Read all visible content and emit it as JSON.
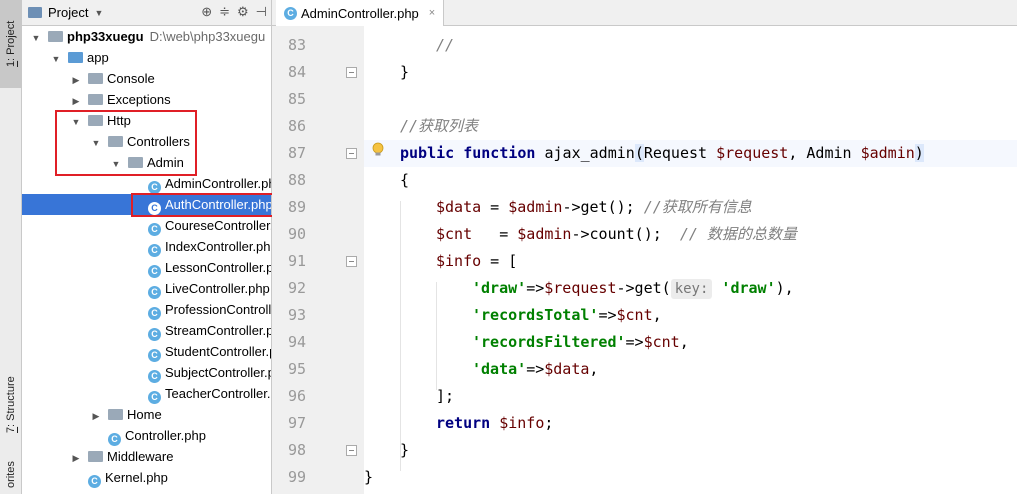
{
  "side_tabs": {
    "project": {
      "num": "1",
      "label": ": Project"
    },
    "structure": {
      "num": "7",
      "label": ": Structure"
    },
    "favorites": "orites"
  },
  "project_panel": {
    "title": "Project",
    "icons": [
      "target-icon",
      "collapse-icon",
      "settings-icon",
      "hide-icon"
    ],
    "tree": [
      {
        "label": "php33xuegu",
        "hint": "D:\\web\\php33xuegu",
        "kind": "root-folder",
        "arrow": "▼"
      },
      {
        "label": "app",
        "kind": "src-folder",
        "arrow": "▼"
      },
      {
        "label": "Console",
        "kind": "folder",
        "arrow": "▶"
      },
      {
        "label": "Exceptions",
        "kind": "folder",
        "arrow": "▶"
      },
      {
        "label": "Http",
        "kind": "folder",
        "arrow": "▼"
      },
      {
        "label": "Controllers",
        "kind": "folder",
        "arrow": "▼"
      },
      {
        "label": "Admin",
        "kind": "folder",
        "arrow": "▼"
      },
      {
        "label": "AdminController.php",
        "kind": "class",
        "arrow": ""
      },
      {
        "label": "AuthController.php",
        "kind": "class",
        "arrow": "",
        "selected": true
      },
      {
        "label": "CoureseController.",
        "kind": "class",
        "arrow": ""
      },
      {
        "label": "IndexController.ph",
        "kind": "class",
        "arrow": ""
      },
      {
        "label": "LessonController.p",
        "kind": "class",
        "arrow": ""
      },
      {
        "label": "LiveController.php",
        "kind": "class",
        "arrow": ""
      },
      {
        "label": "ProfessionControlle",
        "kind": "class",
        "arrow": ""
      },
      {
        "label": "StreamController.p",
        "kind": "class",
        "arrow": ""
      },
      {
        "label": "StudentController.p",
        "kind": "class",
        "arrow": ""
      },
      {
        "label": "SubjectController.p",
        "kind": "class",
        "arrow": ""
      },
      {
        "label": "TeacherController.p",
        "kind": "class",
        "arrow": ""
      },
      {
        "label": "Home",
        "kind": "folder",
        "arrow": "▶"
      },
      {
        "label": "Controller.php",
        "kind": "class",
        "arrow": ""
      },
      {
        "label": "Middleware",
        "kind": "folder",
        "arrow": "▶"
      },
      {
        "label": "Kernel.php",
        "kind": "class",
        "arrow": ""
      }
    ]
  },
  "editor": {
    "tab_label": "AdminController.php",
    "tab_close": "×",
    "line_numbers": [
      "83",
      "84",
      "85",
      "86",
      "87",
      "88",
      "89",
      "90",
      "91",
      "92",
      "93",
      "94",
      "95",
      "96",
      "97",
      "98",
      "99"
    ],
    "lines": {
      "l83": "//",
      "l84": "}",
      "l86": "//获取列表",
      "l87_kw1": "public",
      "l87_kw2": "function",
      "l87_fn": "ajax_admin",
      "l87_paren": "(",
      "l87_t1": "Request ",
      "l87_v1": "$request",
      "l87_t2": ", Admin ",
      "l87_v2": "$admin",
      "l87_close": ")",
      "l88": "{",
      "l89_v": "$data",
      "l89_op": " = ",
      "l89_v2": "$admin",
      "l89_call": "->get(); ",
      "l89_cm": "//获取所有信息",
      "l90_v": "$cnt",
      "l90_op": "   = ",
      "l90_v2": "$admin",
      "l90_call": "->count();  ",
      "l90_cm": "// 数据的总数量",
      "l91_v": "$info",
      "l91_op": " = [",
      "l92_s": "'draw'",
      "l92_op": "=>",
      "l92_v": "$request",
      "l92_call": "->get(",
      "l92_hint": "key:",
      "l92_s2": " 'draw'",
      "l92_end": "),",
      "l93_s": "'recordsTotal'",
      "l93_op": "=>",
      "l93_v": "$cnt",
      "l93_end": ",",
      "l94_s": "'recordsFiltered'",
      "l94_op": "=>",
      "l94_v": "$cnt",
      "l94_end": ",",
      "l95_s": "'data'",
      "l95_op": "=>",
      "l95_v": "$data",
      "l95_end": ",",
      "l96": "];",
      "l97_kw": "return",
      "l97_v": "$info",
      "l97_end": ";",
      "l98": "}",
      "l99": "}"
    }
  }
}
